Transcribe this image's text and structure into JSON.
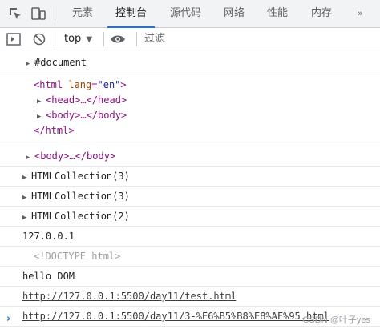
{
  "tabs": [
    "元素",
    "控制台",
    "源代码",
    "网络",
    "性能",
    "内存"
  ],
  "active_tab": "控制台",
  "toolbar": {
    "context": "top",
    "filter_placeholder": "过滤"
  },
  "console_rows": [
    {
      "lines": [
        "#document"
      ]
    },
    {
      "lines": [
        "<html lang=\"en\">",
        "<head>…</head>",
        "<body>…</body>",
        "</html>"
      ]
    },
    {
      "lines": [
        "<body>…</body>"
      ]
    },
    {
      "lines": [
        "HTMLCollection(3)"
      ]
    },
    {
      "lines": [
        "HTMLCollection(3)"
      ]
    },
    {
      "lines": [
        "HTMLCollection(2)"
      ]
    },
    {
      "lines": [
        "127.0.0.1"
      ]
    },
    {
      "lines": [
        "<!DOCTYPE html>"
      ]
    },
    {
      "lines": [
        "hello DOM"
      ]
    },
    {
      "lines": [
        "http://127.0.0.1:5500/day11/test.html"
      ]
    },
    {
      "lines": [
        "http://127.0.0.1:5500/day11/3-%E6%B5%B8%E8%AF%95.html"
      ]
    }
  ],
  "prompt_symbol": "›",
  "watermark": "CSDN @叶子yes",
  "colors": {
    "accent": "#1a73e8",
    "tag": "#881280",
    "attr_name": "#994500",
    "attr_value": "#1a1aa6"
  }
}
